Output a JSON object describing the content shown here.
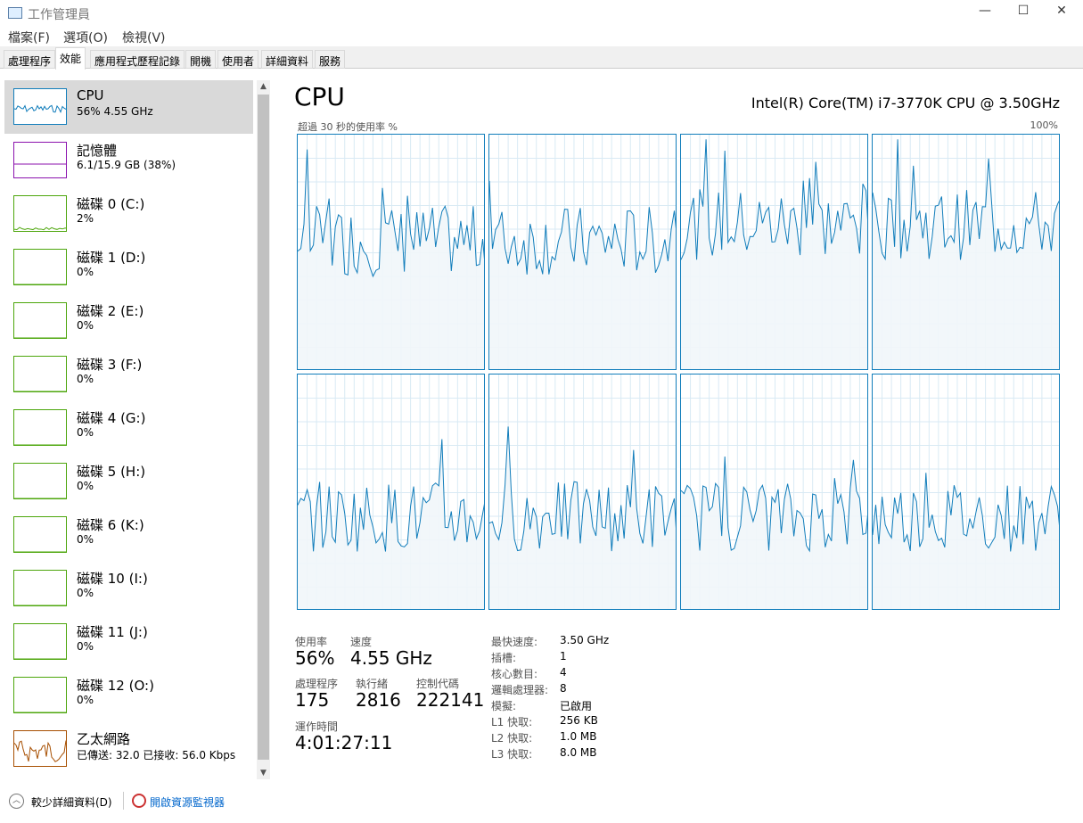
{
  "window": {
    "title": "工作管理員",
    "min": "—",
    "max": "☐",
    "close": "✕"
  },
  "menu": [
    "檔案(F)",
    "選項(O)",
    "檢視(V)"
  ],
  "tabs": [
    "處理程序",
    "效能",
    "應用程式歷程記錄",
    "開機",
    "使用者",
    "詳細資料",
    "服務"
  ],
  "sidebar": [
    {
      "name": "CPU",
      "sub": "56% 4.55 GHz",
      "color": "#117dbb"
    },
    {
      "name": "記憶體",
      "sub": "6.1/15.9 GB (38%)",
      "color": "#8b12ae"
    },
    {
      "name": "磁碟 0 (C:)",
      "sub": "2%",
      "color": "#4da60c"
    },
    {
      "name": "磁碟 1 (D:)",
      "sub": "0%",
      "color": "#4da60c"
    },
    {
      "name": "磁碟 2 (E:)",
      "sub": "0%",
      "color": "#4da60c"
    },
    {
      "name": "磁碟 3 (F:)",
      "sub": "0%",
      "color": "#4da60c"
    },
    {
      "name": "磁碟 4 (G:)",
      "sub": "0%",
      "color": "#4da60c"
    },
    {
      "name": "磁碟 5 (H:)",
      "sub": "0%",
      "color": "#4da60c"
    },
    {
      "name": "磁碟 6 (K:)",
      "sub": "0%",
      "color": "#4da60c"
    },
    {
      "name": "磁碟 10 (I:)",
      "sub": "0%",
      "color": "#4da60c"
    },
    {
      "name": "磁碟 11 (J:)",
      "sub": "0%",
      "color": "#4da60c"
    },
    {
      "name": "磁碟 12 (O:)",
      "sub": "0%",
      "color": "#4da60c"
    },
    {
      "name": "乙太網路",
      "sub": "已傳送: 32.0 已接收: 56.0 Kbps",
      "color": "#a74f01"
    }
  ],
  "main": {
    "title": "CPU",
    "model": "Intel(R) Core(TM) i7-3770K CPU @ 3.50GHz",
    "graph_label": "超過 30 秒的使用率 %",
    "graph_max": "100%",
    "logical_processors_shown": 8
  },
  "stats": {
    "usage_label": "使用率",
    "usage": "56%",
    "speed_label": "速度",
    "speed": "4.55 GHz",
    "processes_label": "處理程序",
    "processes": "175",
    "threads_label": "執行緒",
    "threads": "2816",
    "handles_label": "控制代碼",
    "handles": "222141",
    "uptime_label": "運作時間",
    "uptime": "4:01:27:11"
  },
  "details": [
    {
      "k": "最快速度:",
      "v": "3.50 GHz"
    },
    {
      "k": "插槽:",
      "v": "1"
    },
    {
      "k": "核心數目:",
      "v": "4"
    },
    {
      "k": "邏輯處理器:",
      "v": "8"
    },
    {
      "k": "模擬:",
      "v": "已啟用"
    },
    {
      "k": "L1 快取:",
      "v": "256 KB"
    },
    {
      "k": "L2 快取:",
      "v": "1.0 MB"
    },
    {
      "k": "L3 快取:",
      "v": "8.0 MB"
    }
  ],
  "footer": {
    "fewer": "較少詳細資料(D)",
    "monitor": "開啟資源監視器"
  }
}
